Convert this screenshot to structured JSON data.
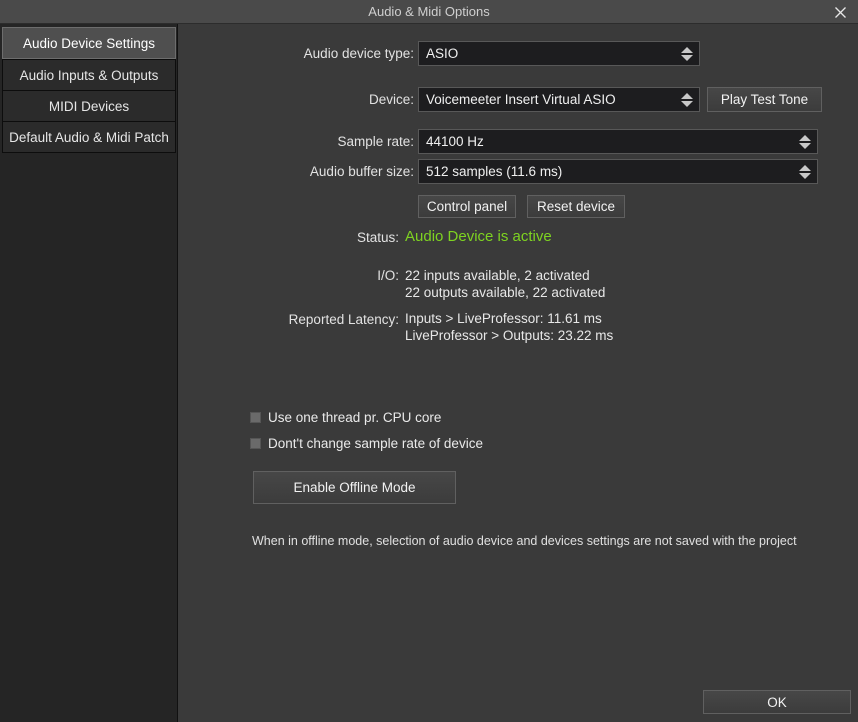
{
  "window": {
    "title": "Audio & Midi Options",
    "close_icon": "close-icon"
  },
  "sidebar": {
    "items": [
      {
        "label": "Audio Device Settings",
        "selected": true
      },
      {
        "label": "Audio Inputs & Outputs",
        "selected": false
      },
      {
        "label": "MIDI Devices",
        "selected": false
      },
      {
        "label": "Default Audio & Midi Patch",
        "selected": false
      }
    ]
  },
  "form": {
    "audio_device_type": {
      "label": "Audio device type:",
      "value": "ASIO"
    },
    "device": {
      "label": "Device:",
      "value": "Voicemeeter Insert Virtual ASIO",
      "test_tone_button": "Play Test Tone"
    },
    "sample_rate": {
      "label": "Sample rate:",
      "value": "44100 Hz"
    },
    "buffer_size": {
      "label": "Audio buffer size:",
      "value": "512 samples (11.6 ms)"
    },
    "control_panel_button": "Control panel",
    "reset_device_button": "Reset device",
    "status": {
      "label": "Status:",
      "value": "Audio Device is active",
      "color": "#7ed321"
    },
    "io": {
      "label": "I/O:",
      "line1": "22 inputs available, 2 activated",
      "line2": "22 outputs available, 22 activated"
    },
    "latency": {
      "label": "Reported Latency:",
      "line1": "Inputs > LiveProfessor: 11.61 ms",
      "line2": "LiveProfessor > Outputs: 23.22 ms"
    },
    "checkboxes": [
      {
        "label": "Use one thread pr. CPU core",
        "checked": false
      },
      {
        "label": "Dont't change sample rate of device",
        "checked": false
      }
    ],
    "offline_mode_button": "Enable Offline Mode",
    "offline_mode_note": "When in offline mode, selection of audio device and devices settings are not saved with the project"
  },
  "footer": {
    "ok_button": "OK"
  }
}
